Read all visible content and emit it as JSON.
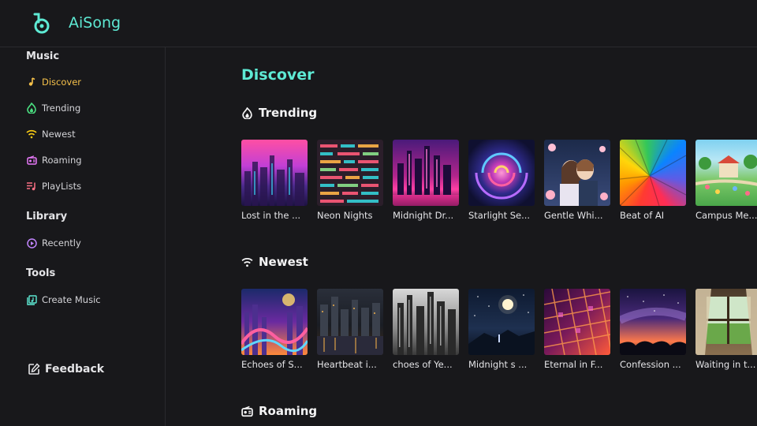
{
  "app": {
    "title": "AiSong",
    "accent": "#5eead4"
  },
  "sidebar": {
    "sections": [
      {
        "title": "Music",
        "items": [
          {
            "label": "Discover",
            "icon": "music-note-icon",
            "color": "#f5c04a",
            "active": true
          },
          {
            "label": "Trending",
            "icon": "flame-icon",
            "color": "#4ade80"
          },
          {
            "label": "Newest",
            "icon": "wifi-icon",
            "color": "#facc15"
          },
          {
            "label": "Roaming",
            "icon": "radio-icon",
            "color": "#e879f9"
          },
          {
            "label": "PlayLists",
            "icon": "playlist-icon",
            "color": "#fb7185"
          }
        ]
      },
      {
        "title": "Library",
        "items": [
          {
            "label": "Recently",
            "icon": "play-circle-icon",
            "color": "#c084fc"
          }
        ]
      },
      {
        "title": "Tools",
        "items": [
          {
            "label": "Create Music",
            "icon": "create-music-icon",
            "color": "#5eead4"
          }
        ]
      }
    ],
    "feedback_label": "Feedback"
  },
  "main": {
    "page_title": "Discover",
    "rows": [
      {
        "title": "Trending",
        "icon": "flame-icon",
        "cards": [
          "Lost in the ...",
          "Neon Nights",
          "Midnight Dr...",
          "Starlight Se...",
          "Gentle Whi...",
          "Beat of AI",
          "Campus Me..."
        ]
      },
      {
        "title": "Newest",
        "icon": "wifi-icon",
        "cards": [
          "Echoes of S...",
          "Heartbeat i...",
          "choes of Ye...",
          "Midnight s ...",
          "Eternal in F...",
          "Confession ...",
          "Waiting in t..."
        ]
      },
      {
        "title": "Roaming",
        "icon": "radio-icon",
        "cards": []
      }
    ]
  }
}
